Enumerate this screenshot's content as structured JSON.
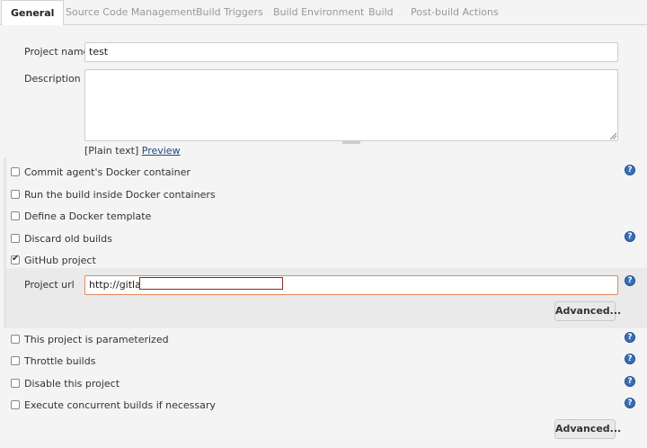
{
  "tabs": [
    {
      "label": "General",
      "active": true
    },
    {
      "label": "Source Code Management"
    },
    {
      "label": "Build Triggers"
    },
    {
      "label": "Build Environment"
    },
    {
      "label": "Build"
    },
    {
      "label": "Post-build Actions"
    }
  ],
  "form": {
    "project_name_label": "Project name",
    "project_name_value": "test",
    "description_label": "Description",
    "description_value": "",
    "plain_text": "[Plain text]",
    "preview_link": "Preview"
  },
  "options": [
    {
      "label": "Commit agent's Docker container",
      "checked": false,
      "help": true
    },
    {
      "label": "Run the build inside Docker containers",
      "checked": false,
      "help": false
    },
    {
      "label": "Define a Docker template",
      "checked": false,
      "help": false
    },
    {
      "label": "Discard old builds",
      "checked": false,
      "help": true
    },
    {
      "label": "GitHub project",
      "checked": true,
      "help": false
    }
  ],
  "github": {
    "project_url_label": "Project url",
    "project_url_value": "http://gitlab.s",
    "advanced_label": "Advanced..."
  },
  "options2": [
    {
      "label": "This project is parameterized",
      "checked": false,
      "help": true
    },
    {
      "label": "Throttle builds",
      "checked": false,
      "help": true
    },
    {
      "label": "Disable this project",
      "checked": false,
      "help": true
    },
    {
      "label": "Execute concurrent builds if necessary",
      "checked": false,
      "help": true
    }
  ],
  "bottom_advanced_label": "Advanced...",
  "icons": {
    "help": "help-icon",
    "checkbox": "checkbox"
  },
  "colors": {
    "link": "#204a87",
    "help": "#3a6fb6",
    "url_border": "#e0895b"
  }
}
